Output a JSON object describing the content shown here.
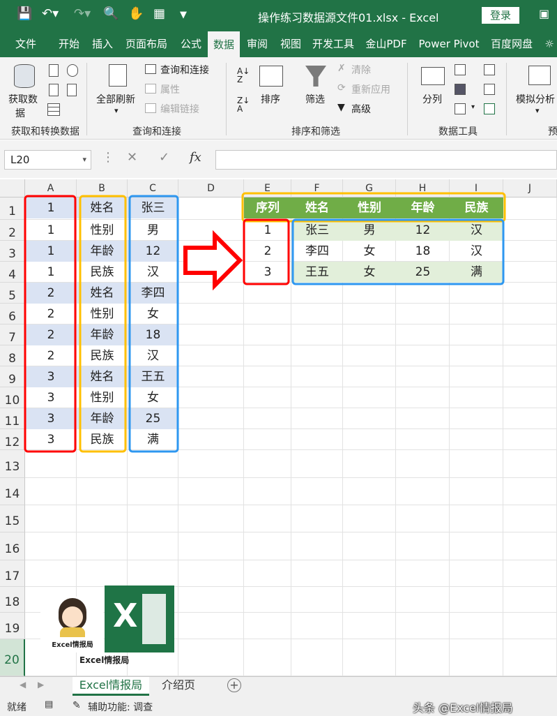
{
  "window": {
    "title": "操作练习数据源文件01.xlsx  -  Excel",
    "login_label": "登录",
    "colors": {
      "accent": "#217346",
      "header_fill": "#70ad47",
      "band_light": "#e2efda",
      "band_blue": "#dae3f3",
      "red": "#ff0000",
      "yellow": "#ffc000",
      "blue": "#2e97f0"
    }
  },
  "tabs": [
    "文件",
    "开始",
    "插入",
    "页面布局",
    "公式",
    "数据",
    "审阅",
    "视图",
    "开发工具",
    "金山PDF",
    "Power Pivot",
    "百度网盘"
  ],
  "ribbon": {
    "get": {
      "button": "获取数",
      "button2": "据",
      "group": "获取和转换数据"
    },
    "query": {
      "refresh_all": "全部刷新",
      "query_connect": "查询和连接",
      "properties": "属性",
      "edit_links": "编辑链接",
      "group": "查询和连接"
    },
    "sort": {
      "sort": "排序",
      "filter": "筛选",
      "clear": "清除",
      "reapply": "重新应用",
      "advanced": "高级",
      "group": "排序和筛选"
    },
    "tools": {
      "split": "分列",
      "group": "数据工具"
    },
    "forecast": {
      "whatif": "模拟分析",
      "group": "预测"
    }
  },
  "formula_bar": {
    "name_box": "L20",
    "fx": "fx"
  },
  "columns": [
    "A",
    "B",
    "C",
    "D",
    "E",
    "F",
    "G",
    "H",
    "I",
    "J"
  ],
  "rows": [
    "1",
    "2",
    "3",
    "4",
    "5",
    "6",
    "7",
    "8",
    "9",
    "10",
    "11",
    "12",
    "13",
    "14",
    "15",
    "16",
    "17",
    "18",
    "19",
    "20"
  ],
  "source": {
    "A": [
      "1",
      "1",
      "1",
      "1",
      "2",
      "2",
      "2",
      "2",
      "3",
      "3",
      "3",
      "3"
    ],
    "B": [
      "姓名",
      "性别",
      "年龄",
      "民族",
      "姓名",
      "性别",
      "年龄",
      "民族",
      "姓名",
      "性别",
      "年龄",
      "民族"
    ],
    "C": [
      "张三",
      "男",
      "12",
      "汉",
      "李四",
      "女",
      "18",
      "汉",
      "王五",
      "女",
      "25",
      "满"
    ]
  },
  "result": {
    "header": [
      "序列",
      "姓名",
      "性别",
      "年龄",
      "民族"
    ],
    "rows": [
      [
        "1",
        "张三",
        "男",
        "12",
        "汉"
      ],
      [
        "2",
        "李四",
        "女",
        "18",
        "汉"
      ],
      [
        "3",
        "王五",
        "女",
        "25",
        "满"
      ]
    ]
  },
  "watermark": {
    "logo_caption": "Excel情报局",
    "caption": "Excel情报局"
  },
  "sheets": [
    "Excel情报局",
    "介绍页"
  ],
  "status": {
    "ready": "就绪",
    "accessibility": "辅助功能: 调查",
    "credit": "头条 @Excel情报局"
  }
}
